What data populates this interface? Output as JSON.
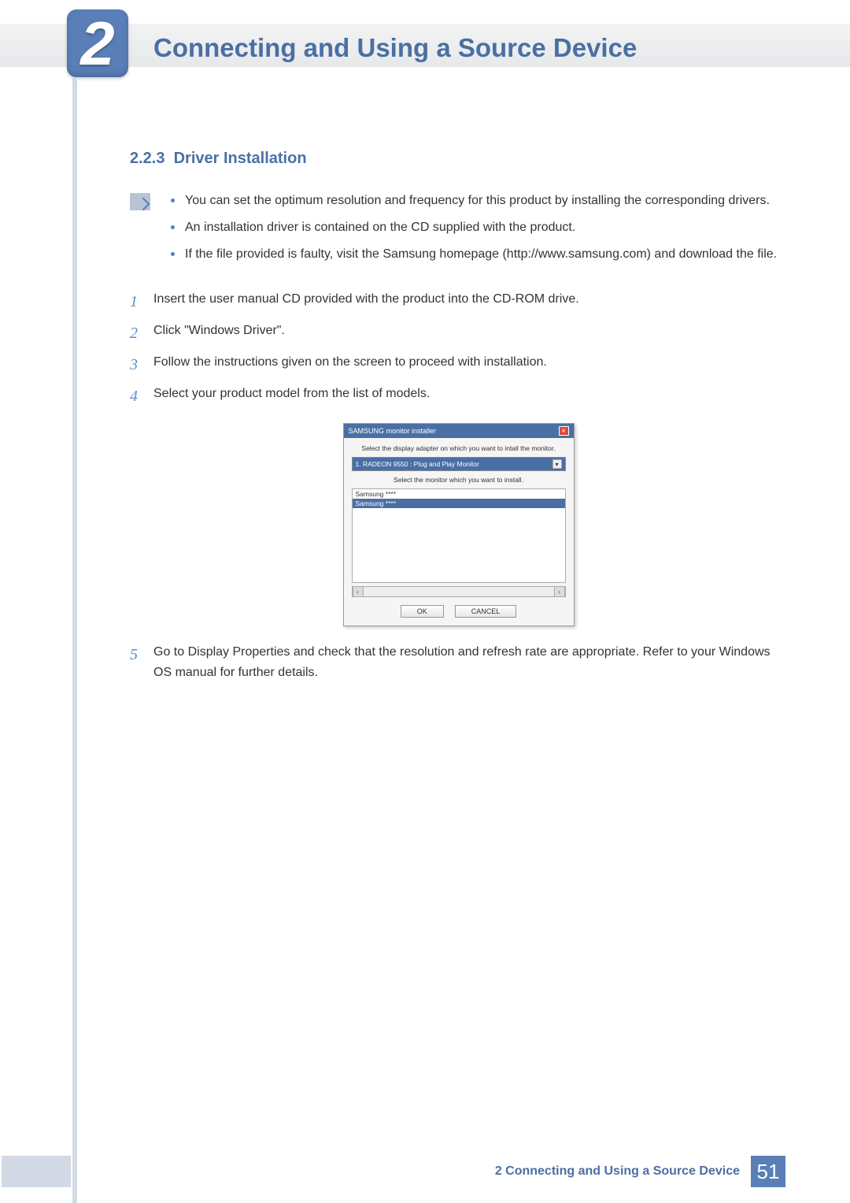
{
  "header": {
    "chapter_number": "2",
    "chapter_title": "Connecting and Using a Source Device"
  },
  "section": {
    "number": "2.2.3",
    "title": "Driver Installation"
  },
  "note_bullets": [
    "You can set the optimum resolution and frequency for this product by installing the corresponding drivers.",
    "An installation driver is contained on the CD supplied with the product.",
    "If the file provided is faulty, visit the Samsung homepage (http://www.samsung.com) and download the file."
  ],
  "steps": [
    {
      "n": "1",
      "text": "Insert the user manual CD provided with the product into the CD-ROM drive."
    },
    {
      "n": "2",
      "text": "Click \"Windows Driver\"."
    },
    {
      "n": "3",
      "text": "Follow the instructions given on the screen to proceed with installation."
    },
    {
      "n": "4",
      "text": "Select your product model from the list of models."
    }
  ],
  "installer": {
    "title": "SAMSUNG monitor installer",
    "label1": "Select the display adapter on which you want to intall the monitor.",
    "select_text": "1. RADEON 9550 : Plug and Play Monitor",
    "label2": "Select the monitor which you want to install.",
    "list": [
      "Samsung ****",
      "Samsung ****"
    ],
    "ok": "OK",
    "cancel": "CANCEL"
  },
  "step5": {
    "n": "5",
    "text": "Go to Display Properties and check that the resolution and refresh rate are appropriate. Refer to your Windows OS manual for further details."
  },
  "footer": {
    "text": "2 Connecting and Using a Source Device",
    "page": "51"
  }
}
